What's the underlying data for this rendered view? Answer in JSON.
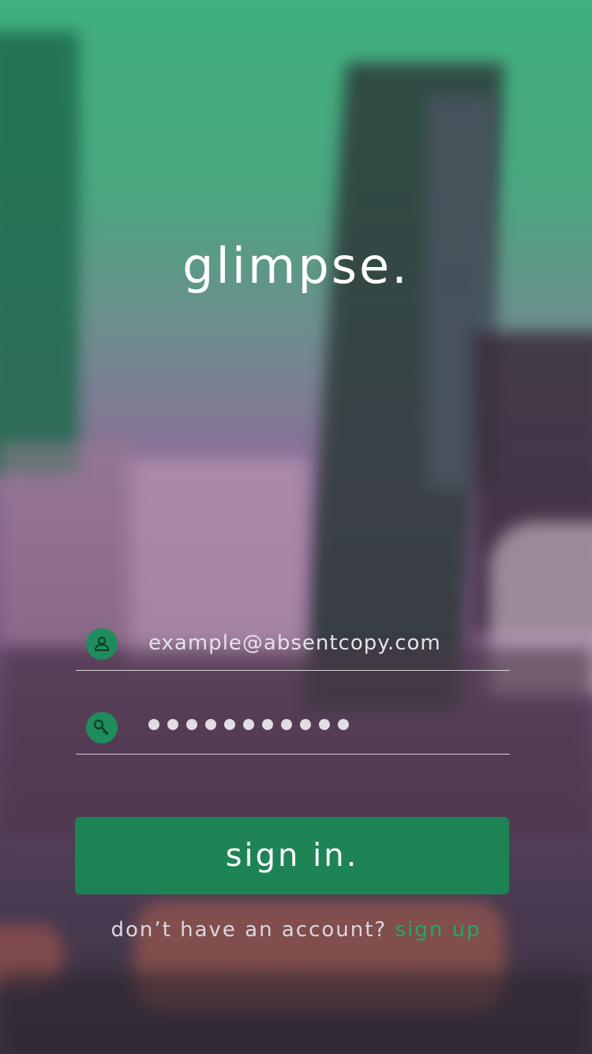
{
  "app": {
    "logo_text": "glimpse."
  },
  "form": {
    "email": {
      "value": "example@absentcopy.com",
      "icon": "user-icon"
    },
    "password": {
      "masked_length": 11,
      "icon": "key-icon"
    },
    "signin_label": "sign in."
  },
  "footer": {
    "prompt": "don’t have an account?",
    "signup_label": "sign up"
  },
  "colors": {
    "accent": "#1f8c5e",
    "button": "#188c55",
    "link": "#23a86c",
    "text": "#ffffff"
  }
}
